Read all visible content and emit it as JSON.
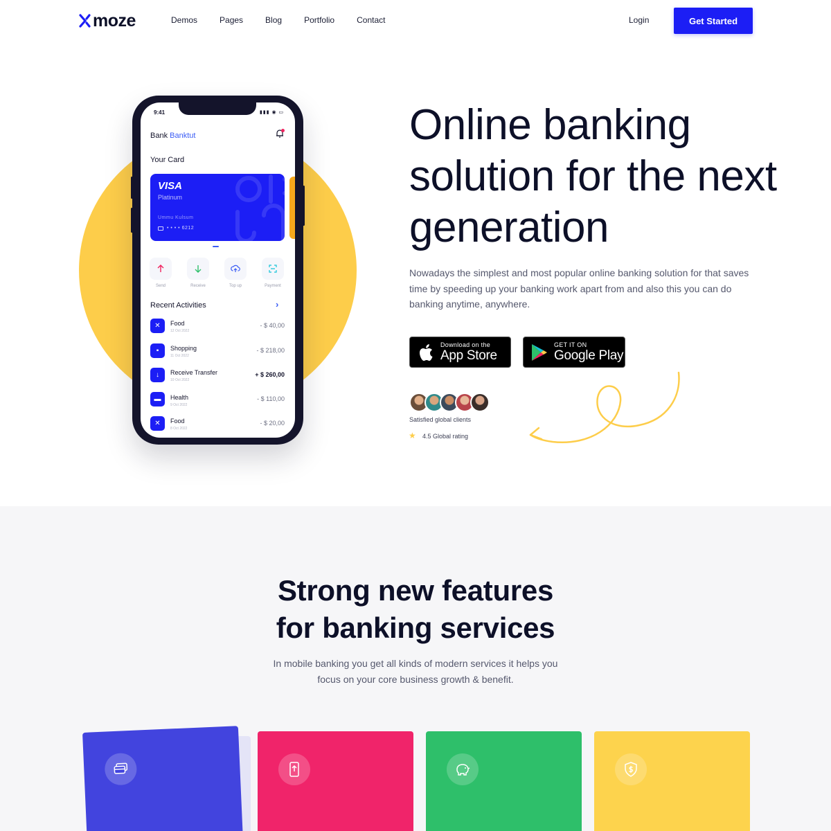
{
  "nav": {
    "logo": "moze",
    "links": [
      "Demos",
      "Pages",
      "Blog",
      "Portfolio",
      "Contact"
    ],
    "login": "Login",
    "cta": "Get Started"
  },
  "hero": {
    "title": "Online banking solution for the next generation",
    "description": "Nowadays the simplest and most popular online banking solution for that saves time by speeding up your banking work apart from and also this you can do banking anytime, anywhere.",
    "app_store": {
      "small": "Download on the",
      "big": "App Store"
    },
    "google_play": {
      "small": "GET IT ON",
      "big": "Google Play"
    },
    "clients_label": "Satisfied global clients",
    "rating_label": "4.5 Global rating"
  },
  "phone": {
    "time": "9:41",
    "app_title_prefix": "Bank",
    "app_title_brand": "Banktut",
    "your_card": "Your Card",
    "card": {
      "brand": "VISA",
      "tier": "Platinum",
      "holder": "Ummu Kulsum",
      "number": "• • • •  6212"
    },
    "actions": [
      "Send",
      "Receive",
      "Top up",
      "Payment"
    ],
    "recent_title": "Recent Activities",
    "activities": [
      {
        "name": "Food",
        "date": "12 Oct 2022",
        "amount": "- $ 40,00",
        "icon": "✕"
      },
      {
        "name": "Shopping",
        "date": "11 Oct 2022",
        "amount": "- $ 218,00",
        "icon": "▪"
      },
      {
        "name": "Receive Transfer",
        "date": "10 Oct 2022",
        "amount": "+ $ 260,00",
        "icon": "↓"
      },
      {
        "name": "Health",
        "date": "9 Oct 2022",
        "amount": "- $ 110,00",
        "icon": "▬"
      },
      {
        "name": "Food",
        "date": "8 Oct 2022",
        "amount": "- $ 20,00",
        "icon": "✕"
      }
    ]
  },
  "features": {
    "title_line1": "Strong new features",
    "title_line2": "for banking services",
    "description": "In mobile banking you get all kinds of modern services it helps you focus on your core business growth & benefit.",
    "cards": [
      {
        "icon": "cards-icon",
        "color": "#4244de"
      },
      {
        "icon": "mobile-transfer-icon",
        "color": "#f0246a"
      },
      {
        "icon": "piggy-bank-icon",
        "color": "#2ebf6a"
      },
      {
        "icon": "shield-dollar-icon",
        "color": "#fdd34d"
      }
    ]
  },
  "colors": {
    "primary": "#1c1ef5",
    "accent_yellow": "#fdcd4a",
    "text_dark": "#0d1028",
    "text_muted": "#55586d"
  }
}
